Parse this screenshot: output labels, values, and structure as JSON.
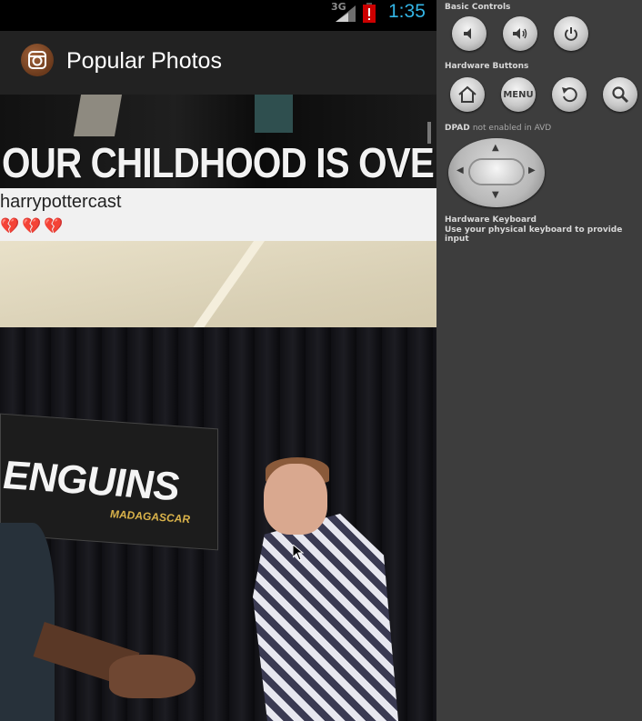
{
  "status_bar": {
    "network": "3G",
    "time": "1:35"
  },
  "action_bar": {
    "app_icon": "instagram-camera-icon",
    "title": "Popular Photos"
  },
  "feed": [
    {
      "image_caption": "OUR CHILDHOOD IS OVE",
      "username": "harrypottercast",
      "likes": "💔💔💔"
    },
    {
      "image_caption": "ENGUINS",
      "image_subcaption": "MADAGASCAR"
    }
  ],
  "emulator_controls": {
    "basic_controls_title": "Basic Controls",
    "basic_buttons": [
      "volume-down-icon",
      "volume-up-icon",
      "power-icon"
    ],
    "hardware_buttons_title": "Hardware Buttons",
    "hardware_buttons": [
      "home-icon",
      "MENU",
      "back-icon",
      "search-icon"
    ],
    "dpad_label": "DPAD",
    "dpad_note": "not enabled in AVD",
    "keyboard_title": "Hardware Keyboard",
    "keyboard_note": "Use your physical keyboard to provide input"
  },
  "colors": {
    "accent": "#33b5e5",
    "battery_alert": "#cc0000",
    "action_bar": "#222222",
    "sidebar": "#3d3d3d"
  }
}
